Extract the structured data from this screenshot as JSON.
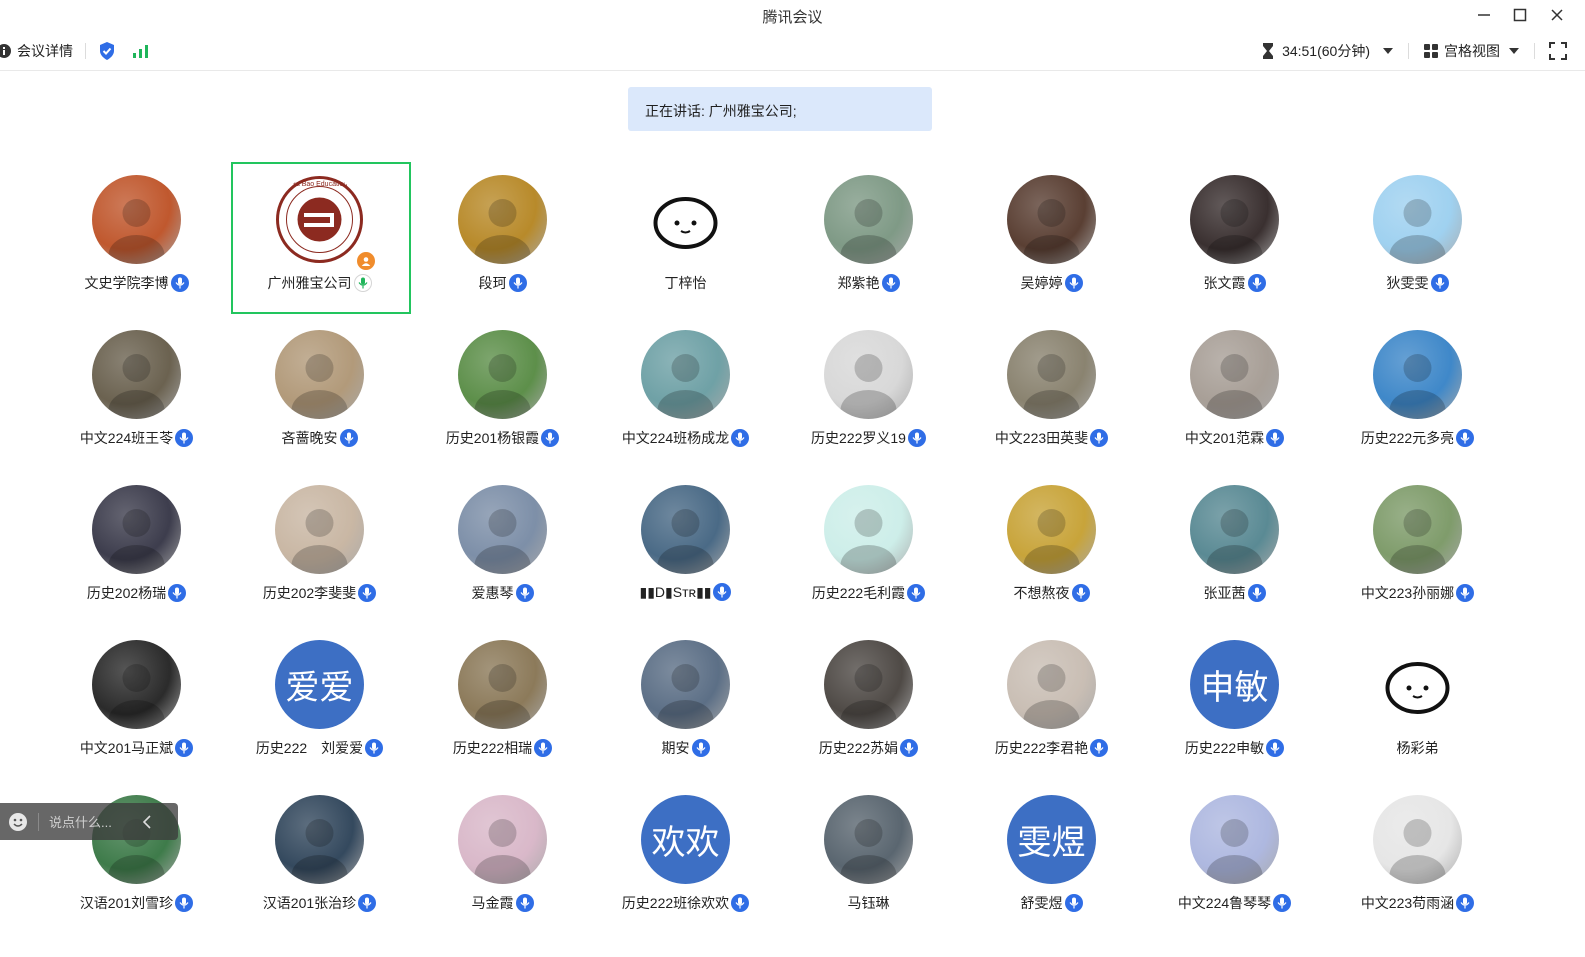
{
  "window": {
    "title": "腾讯会议"
  },
  "toolbar": {
    "meeting_details": "会议详情",
    "timer": "34:51(60分钟)",
    "view_mode": "宫格视图"
  },
  "speaking_banner": "正在讲话: 广州雅宝公司;",
  "chat": {
    "placeholder": "说点什么..."
  },
  "participants": [
    {
      "name": "文史学院李博",
      "color": "#c0582e",
      "mic": "muted"
    },
    {
      "name": "广州雅宝公司",
      "color": "#ffffff",
      "mic": "active",
      "host": true,
      "logo_text": "Ya Bao Education"
    },
    {
      "name": "段珂",
      "color": "#b88a2a",
      "mic": "muted"
    },
    {
      "name": "丁梓怡",
      "color": "#ffffff",
      "mic": "none"
    },
    {
      "name": "郑紫艳",
      "color": "#7f9a86",
      "mic": "muted"
    },
    {
      "name": "吴婷婷",
      "color": "#5a3f33",
      "mic": "muted"
    },
    {
      "name": "张文霞",
      "color": "#3a3030",
      "mic": "muted"
    },
    {
      "name": "狄雯雯",
      "color": "#9fd1f0",
      "mic": "muted"
    },
    {
      "name": "中文224班王苓",
      "color": "#6b6250",
      "mic": "muted"
    },
    {
      "name": "吝蔷晚安",
      "color": "#b29a7a",
      "mic": "muted"
    },
    {
      "name": "历史201杨银霞",
      "color": "#5d8f4a",
      "mic": "muted"
    },
    {
      "name": "中文224班杨成龙",
      "color": "#6fa1a6",
      "mic": "muted"
    },
    {
      "name": "历史222罗义19",
      "color": "#d8d8d8",
      "mic": "muted"
    },
    {
      "name": "中文223田英斐",
      "color": "#8a8370",
      "mic": "muted"
    },
    {
      "name": "中文201范霖",
      "color": "#a89f97",
      "mic": "muted"
    },
    {
      "name": "历史222元多亮",
      "color": "#3f88c9",
      "mic": "muted"
    },
    {
      "name": "历史202杨瑞",
      "color": "#3d3d4d",
      "mic": "muted"
    },
    {
      "name": "历史202李斐斐",
      "color": "#c9b7a4",
      "mic": "muted"
    },
    {
      "name": "爱惠琴",
      "color": "#7d8fa8",
      "mic": "muted"
    },
    {
      "name": "▮▮D▮Sᴛʀ▮▮",
      "color": "#4a6a86",
      "mic": "muted"
    },
    {
      "name": "历史222毛利霞",
      "color": "#cdeee9",
      "mic": "muted"
    },
    {
      "name": "不想熬夜",
      "color": "#c8a43a",
      "mic": "muted"
    },
    {
      "name": "张亚茜",
      "color": "#5a8a94",
      "mic": "muted"
    },
    {
      "name": "中文223孙丽娜",
      "color": "#7f9c6b",
      "mic": "muted"
    },
    {
      "name": "中文201马正斌",
      "color": "#2b2b2b",
      "mic": "muted"
    },
    {
      "name": "历史222　刘爱爱",
      "color": "",
      "text": "爱爱",
      "mic": "muted"
    },
    {
      "name": "历史222相瑞",
      "color": "#8c7a5a",
      "mic": "muted"
    },
    {
      "name": "期安",
      "color": "#5c6f86",
      "mic": "muted"
    },
    {
      "name": "历史222苏娟",
      "color": "#4f4a46",
      "mic": "muted"
    },
    {
      "name": "历史222李君艳",
      "color": "#c9beb4",
      "mic": "muted"
    },
    {
      "name": "历史222申敏",
      "color": "",
      "text": "申敏",
      "mic": "muted"
    },
    {
      "name": "杨彩弟",
      "color": "#ffffff",
      "mic": "none"
    },
    {
      "name": "汉语201刘雪珍",
      "color": "#3e7b4a",
      "mic": "muted"
    },
    {
      "name": "汉语201张治珍",
      "color": "#34495e",
      "mic": "muted"
    },
    {
      "name": "马金霞",
      "color": "#d9b8c9",
      "mic": "muted"
    },
    {
      "name": "历史222班徐欢欢",
      "color": "",
      "text": "欢欢",
      "mic": "muted"
    },
    {
      "name": "马钰琳",
      "color": "#5a6670",
      "mic": "none"
    },
    {
      "name": "舒雯煜",
      "color": "",
      "text": "雯煜",
      "mic": "muted"
    },
    {
      "name": "中文224鲁琴琴",
      "color": "#aeb8e0",
      "mic": "muted"
    },
    {
      "name": "中文223苟雨涵",
      "color": "#e6e6e6",
      "mic": "muted"
    }
  ]
}
